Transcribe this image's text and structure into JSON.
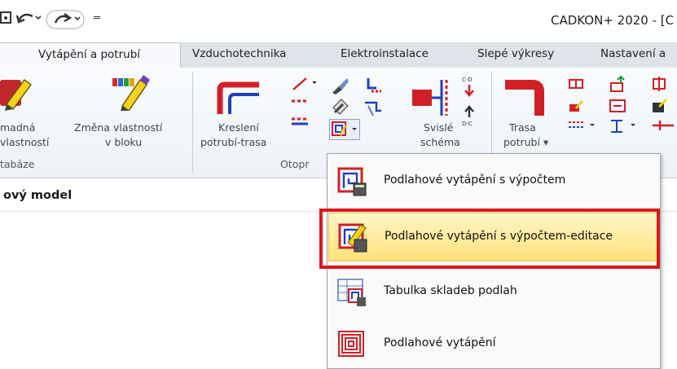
{
  "window": {
    "title": "CADKON+ 2020 - [C"
  },
  "quick_access": {
    "more_symbol": "═"
  },
  "tabs": [
    {
      "label": "Vytápění a potrubí",
      "active": true
    },
    {
      "label": "Vzduchotechnika"
    },
    {
      "label": "Elektroinstalace"
    },
    {
      "label": "Slepé výkresy"
    },
    {
      "label": "Nastavení a"
    }
  ],
  "ribbon": {
    "buttons": {
      "edit_properties": [
        "madná",
        "vlastností"
      ],
      "change_block_props": [
        "Změna vlastností",
        "v bloku"
      ],
      "draw_pipe_route": [
        "Kreslení",
        "potrubí-trasa"
      ],
      "vertical_scheme": [
        "Svislé",
        "schéma"
      ],
      "pipe_route": [
        "Trasa",
        "potrubí ▾"
      ]
    },
    "group_labels": {
      "database": "tabáze",
      "heating": "Otopr"
    }
  },
  "document": {
    "tab_label": "ový model"
  },
  "dropdown": {
    "items": [
      {
        "label": "Podlahové vytápění s výpočtem",
        "icon": "floor-heating-calc-icon"
      },
      {
        "label": "Podlahové vytápění s výpočtem-editace",
        "icon": "floor-heating-calc-edit-icon",
        "highlighted": true
      },
      {
        "label": "Tabulka skladeb podlah",
        "icon": "floor-composition-table-icon"
      },
      {
        "label": "Podlahové vytápění",
        "icon": "floor-heating-icon"
      }
    ]
  },
  "colors": {
    "highlight_border": "#e0151b",
    "hover_fill": "#ffe27a",
    "pipe_red": "#d21f26",
    "pipe_blue": "#1f3fbf"
  }
}
